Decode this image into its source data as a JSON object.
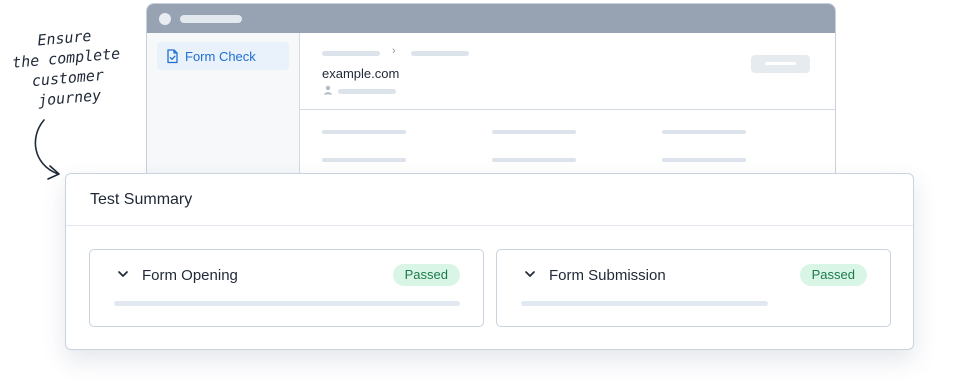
{
  "annotation": {
    "lines": [
      "Ensure",
      "the complete",
      "customer",
      "journey"
    ]
  },
  "app": {
    "sidebar": {
      "items": [
        {
          "label": "Form Check",
          "icon": "document-check-icon",
          "active": true
        }
      ]
    },
    "header": {
      "site": "example.com"
    }
  },
  "summary": {
    "title": "Test Summary",
    "tests": [
      {
        "name": "Form Opening",
        "status": "Passed",
        "icon": "chevron-down-icon"
      },
      {
        "name": "Form Submission",
        "status": "Passed",
        "icon": "chevron-down-icon"
      }
    ]
  },
  "colors": {
    "accent": "#1f6fd1",
    "passed_bg": "#d9f5e6",
    "passed_text": "#1e7a4c",
    "titlebar": "#97a3b3"
  }
}
